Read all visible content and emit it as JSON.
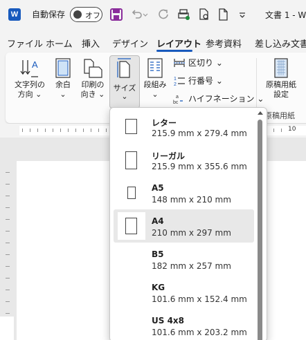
{
  "titlebar": {
    "logo": "W",
    "autosave_label": "自動保存",
    "toggle_state": "オフ",
    "doc_title": "文書 1 - W"
  },
  "tabs": [
    "ファイル",
    "ホーム",
    "挿入",
    "デザイン",
    "レイアウト",
    "参考資料",
    "差し込み文書"
  ],
  "active_tab": "レイアウト",
  "ribbon": {
    "text_direction": [
      "文字列の",
      "方向 ⌄"
    ],
    "margins": [
      "余白",
      "⌄"
    ],
    "orientation": [
      "印刷の",
      "向き ⌄"
    ],
    "size": [
      "サイズ",
      "⌄"
    ],
    "columns": [
      "段組み",
      "⌄"
    ],
    "breaks": "区切り ⌄",
    "line_numbers": "行番号 ⌄",
    "hyphenation": "ハイフネーション ⌄",
    "genkou": [
      "原稿用紙",
      "設定"
    ],
    "genkou_group": "原稿用紙"
  },
  "ruler_label": "10",
  "size_menu": {
    "items": [
      {
        "name": "レター",
        "dim": "215.9 mm x 279.4 mm",
        "selected": false
      },
      {
        "name": "リーガル",
        "dim": "215.9 mm x 355.6 mm",
        "selected": false
      },
      {
        "name": "A5",
        "dim": "148 mm x 210 mm",
        "selected": false
      },
      {
        "name": "A4",
        "dim": "210 mm x 297 mm",
        "selected": true
      },
      {
        "name": "B5",
        "dim": "182 mm x 257 mm",
        "selected": false
      },
      {
        "name": "KG",
        "dim": "101.6 mm x 152.4 mm",
        "selected": false
      },
      {
        "name": "US 4x8",
        "dim": "101.6 mm x 203.2 mm",
        "selected": false
      }
    ]
  },
  "colors": {
    "accent": "#185abd",
    "purple_save": "#8a2c9b"
  }
}
